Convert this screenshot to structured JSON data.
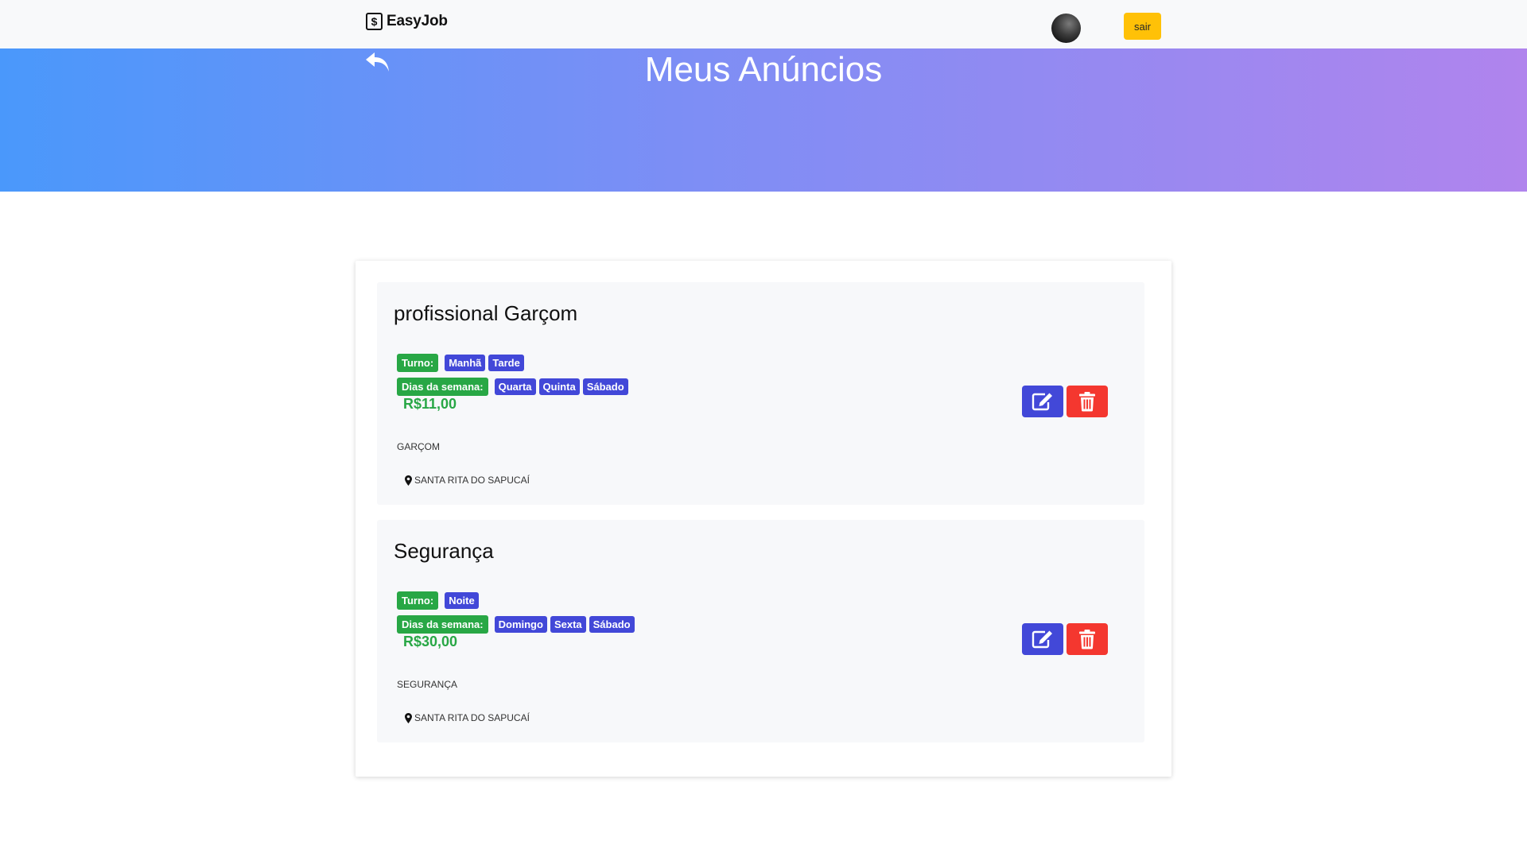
{
  "navbar": {
    "brand": "EasyJob",
    "logout_label": "sair"
  },
  "hero": {
    "title": "Meus Anúncios"
  },
  "listings": [
    {
      "title": "profissional Garçom",
      "shift_label": "Turno:",
      "shifts": [
        "Manhã",
        "Tarde"
      ],
      "days_label": "Dias da semana:",
      "days": [
        "Quarta",
        "Quinta",
        "Sábado"
      ],
      "price": "R$11,00",
      "category": "GARÇOM",
      "location": "SANTA RITA DO SAPUCAÍ"
    },
    {
      "title": "Segurança",
      "shift_label": "Turno:",
      "shifts": [
        "Noite"
      ],
      "days_label": "Dias da semana:",
      "days": [
        "Domingo",
        "Sexta",
        "Sábado"
      ],
      "price": "R$30,00",
      "category": "SEGURANÇA",
      "location": "SANTA RITA DO SAPUCAÍ"
    }
  ],
  "icons": {
    "brand": "dollar-sign-square-icon",
    "back": "reply-arrow-icon",
    "edit": "pencil-square-icon",
    "delete": "trash-icon",
    "location": "map-marker-icon"
  },
  "colors": {
    "accent_green": "#28a745",
    "badge_blue": "#4248d8",
    "delete_red": "#f4372f",
    "logout_yellow": "#ffc107",
    "hero_gradient_start": "#4a98fb",
    "hero_gradient_end": "#b084ed"
  }
}
